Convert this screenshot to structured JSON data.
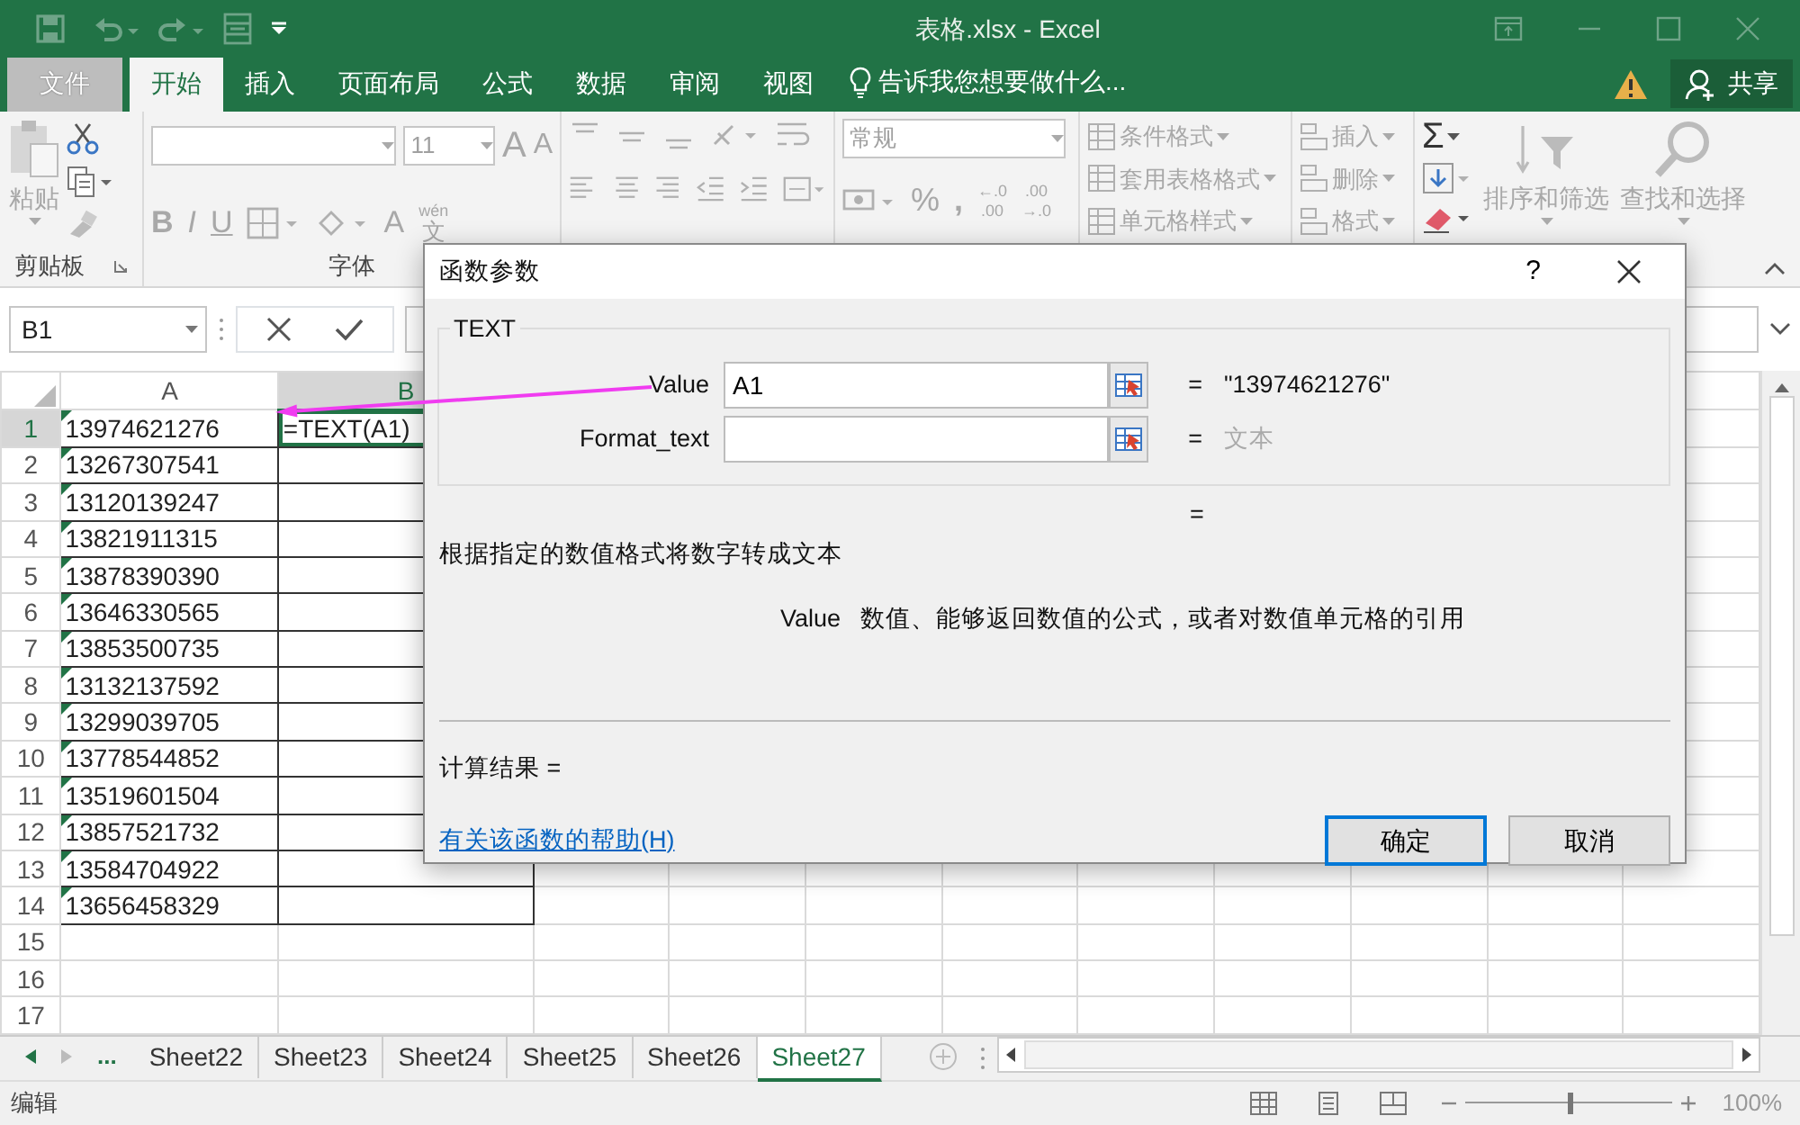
{
  "title_bar": {
    "title": "表格.xlsx - Excel"
  },
  "ribbon_tabs": [
    {
      "label": "文件",
      "kind": "file",
      "selected": false
    },
    {
      "label": "开始",
      "kind": "tab",
      "selected": true
    },
    {
      "label": "插入",
      "kind": "tab",
      "selected": false
    },
    {
      "label": "页面布局",
      "kind": "tab",
      "selected": false
    },
    {
      "label": "公式",
      "kind": "tab",
      "selected": false
    },
    {
      "label": "数据",
      "kind": "tab",
      "selected": false
    },
    {
      "label": "审阅",
      "kind": "tab",
      "selected": false
    },
    {
      "label": "视图",
      "kind": "tab",
      "selected": false
    }
  ],
  "tell_me": "告诉我您想要做什么...",
  "share": "共享",
  "ribbon": {
    "clipboard": {
      "paste": "粘贴",
      "label": "剪贴板"
    },
    "font": {
      "size": "11",
      "grow": "A",
      "shrink": "A",
      "styles": [
        "B",
        "I",
        "U"
      ],
      "font_color": "A",
      "phonetic_top": "wén",
      "phonetic_bottom": "文",
      "label": "字体"
    },
    "number": {
      "format": "常规",
      "percent": "%",
      "comma": ",",
      "decimals": [
        {
          "top": "←.0",
          "bottom": ".00"
        },
        {
          "top": ".00",
          "bottom": "→.0"
        }
      ]
    },
    "styles": [
      "条件格式",
      "套用表格格式",
      "单元格样式"
    ],
    "cells": [
      "插入",
      "删除",
      "格式"
    ],
    "editing": {
      "sum": "Σ",
      "sort": "排序和筛选",
      "find": "查找和选择"
    }
  },
  "formula_bar": {
    "name_box": "B1"
  },
  "sheet": {
    "columns": [
      {
        "label": "A",
        "selected": false
      },
      {
        "label": "B",
        "selected": true
      }
    ],
    "rows": [
      {
        "number": "1",
        "a": "13974621276",
        "b": "=TEXT(A1)",
        "selected": true,
        "flagged": true,
        "bordered": true
      },
      {
        "number": "2",
        "a": "13267307541",
        "selected": false,
        "flagged": true,
        "bordered": true
      },
      {
        "number": "3",
        "a": "13120139247",
        "selected": false,
        "flagged": true,
        "bordered": true
      },
      {
        "number": "4",
        "a": "13821911315",
        "selected": false,
        "flagged": true,
        "bordered": true
      },
      {
        "number": "5",
        "a": "13878390390",
        "selected": false,
        "flagged": true,
        "bordered": true
      },
      {
        "number": "6",
        "a": "13646330565",
        "selected": false,
        "flagged": true,
        "bordered": true
      },
      {
        "number": "7",
        "a": "13853500735",
        "selected": false,
        "flagged": true,
        "bordered": true
      },
      {
        "number": "8",
        "a": "13132137592",
        "selected": false,
        "flagged": true,
        "bordered": true
      },
      {
        "number": "9",
        "a": "13299039705",
        "selected": false,
        "flagged": true,
        "bordered": true
      },
      {
        "number": "10",
        "a": "13778544852",
        "selected": false,
        "flagged": true,
        "bordered": true
      },
      {
        "number": "11",
        "a": "13519601504",
        "selected": false,
        "flagged": true,
        "bordered": true
      },
      {
        "number": "12",
        "a": "13857521732",
        "selected": false,
        "flagged": true,
        "bordered": true
      },
      {
        "number": "13",
        "a": "13584704922",
        "selected": false,
        "flagged": true,
        "bordered": true
      },
      {
        "number": "14",
        "a": "13656458329",
        "selected": false,
        "flagged": true,
        "bordered": true
      },
      {
        "number": "15",
        "selected": false,
        "flagged": false,
        "bordered": false
      },
      {
        "number": "16",
        "selected": false,
        "flagged": false,
        "bordered": false
      },
      {
        "number": "17",
        "selected": false,
        "flagged": false,
        "bordered": false
      }
    ]
  },
  "dialog": {
    "title": "函数参数",
    "help": "?",
    "function_name": "TEXT",
    "arguments": [
      {
        "label": "Value",
        "value": "A1",
        "equals": "=",
        "result": "\"13974621276\"",
        "greyed": false
      },
      {
        "label": "Format_text",
        "equals": "=",
        "result": "文本",
        "greyed": true
      }
    ],
    "total_equals": "=",
    "description": "根据指定的数值格式将数字转成文本",
    "argument_help": {
      "name": "Value",
      "text": "数值、能够返回数值的公式，或者对数值单元格的引用"
    },
    "result_label": "计算结果 =",
    "help_link": "有关该函数的帮助(H)",
    "buttons": [
      {
        "label": "确定",
        "default": true
      },
      {
        "label": "取消",
        "default": false
      }
    ]
  },
  "sheet_tabs": {
    "more": "...",
    "tabs": [
      {
        "label": "Sheet22",
        "selected": false
      },
      {
        "label": "Sheet23",
        "selected": false
      },
      {
        "label": "Sheet24",
        "selected": false
      },
      {
        "label": "Sheet25",
        "selected": false
      },
      {
        "label": "Sheet26",
        "selected": false
      },
      {
        "label": "Sheet27",
        "selected": true
      }
    ]
  },
  "status_bar": {
    "mode": "编辑",
    "zoom": "100%",
    "zoom_slider": {
      "level": 0.5
    }
  }
}
